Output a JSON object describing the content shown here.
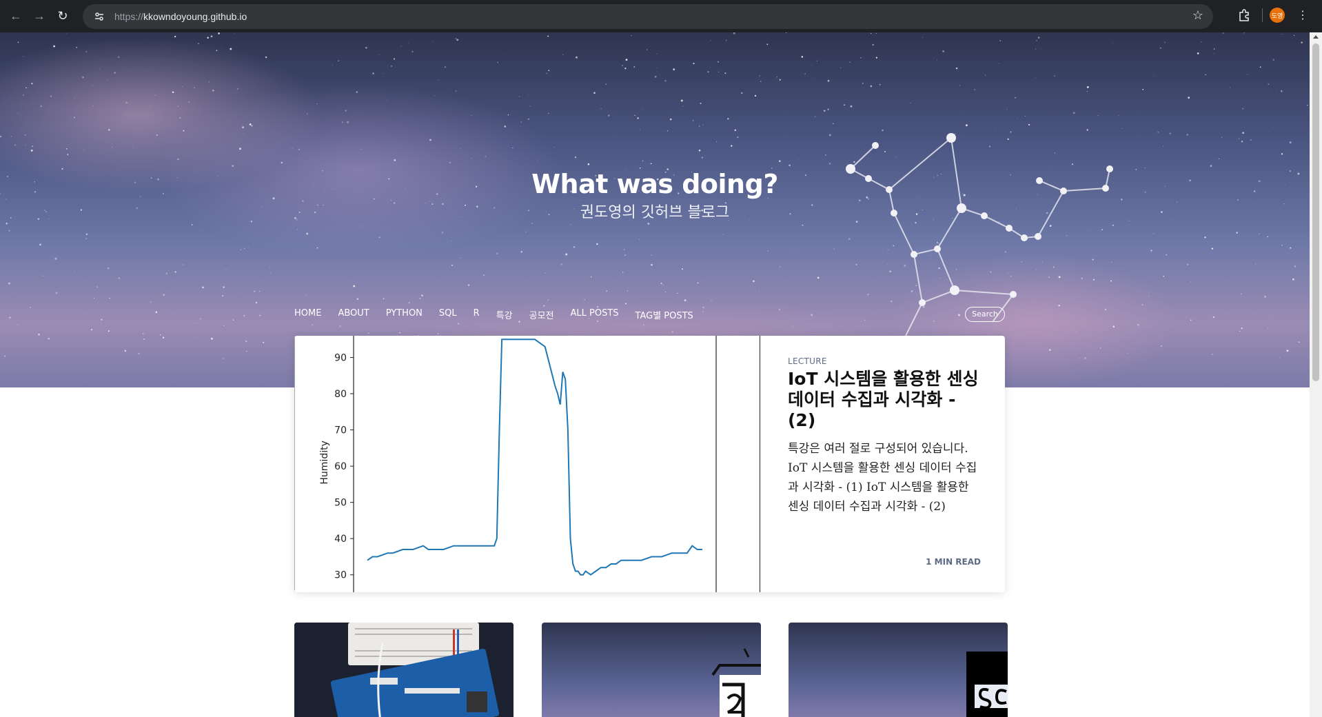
{
  "browser": {
    "url_scheme": "https://",
    "url_host": "kkowndoyoung.github.io",
    "profile_initials": "도영",
    "icons": [
      "back-icon",
      "forward-icon",
      "reload-icon",
      "site-info-icon",
      "bookmark-star-icon",
      "extensions-icon",
      "menu-icon"
    ]
  },
  "hero": {
    "title": "What was doing?",
    "subtitle": "권도영의 깃허브 블로그"
  },
  "nav": {
    "items": [
      "HOME",
      "ABOUT",
      "PYTHON",
      "SQL",
      "R",
      "특강",
      "공모전",
      "ALL POSTS",
      "TAG별 POSTS"
    ],
    "search_label": "Search"
  },
  "featured": {
    "category": "LECTURE",
    "title": "IoT 시스템을 활용한 센싱 데이터 수집과 시각화 - (2)",
    "excerpt": "특강은 여러 절로 구성되어 있습니다. IoT 시스템을 활용한 센싱 데이터 수집과 시각화 - (1) IoT 시스템을 활용한 센싱 데이터 수집과 시각화 - (2)",
    "read_time": "1 MIN READ"
  },
  "chart_data": {
    "type": "line",
    "ylabel": "Humidity",
    "xlabel": "",
    "title": "",
    "ylim": [
      29,
      96
    ],
    "yticks": [
      30,
      40,
      50,
      60,
      70,
      80,
      90
    ],
    "series": [
      {
        "color": "#1f77b4",
        "x": [
          0,
          2,
          4,
          8,
          10,
          14,
          18,
          22,
          24,
          26,
          30,
          34,
          38,
          42,
          46,
          50,
          51,
          52,
          53,
          54,
          55,
          56,
          57,
          58,
          60,
          62,
          66,
          70,
          74,
          75,
          76,
          77,
          78,
          79,
          80,
          81,
          82,
          83,
          84,
          85,
          86,
          88,
          90,
          92,
          94,
          96,
          98,
          100,
          104,
          108,
          112,
          116,
          120,
          124,
          126,
          128,
          130,
          132
        ],
        "y": [
          34,
          35,
          35,
          36,
          36,
          37,
          37,
          38,
          37,
          37,
          37,
          38,
          38,
          38,
          38,
          38,
          40,
          70,
          95,
          95,
          95,
          95,
          95,
          95,
          95,
          95,
          95,
          93,
          82,
          80,
          77,
          86,
          84,
          70,
          40,
          33,
          31,
          31,
          30,
          30,
          31,
          30,
          31,
          32,
          32,
          33,
          33,
          34,
          34,
          34,
          35,
          35,
          36,
          36,
          36,
          38,
          37,
          37
        ]
      }
    ]
  },
  "cards": [
    {
      "name": "arduino-card"
    },
    {
      "name": "card-2"
    },
    {
      "name": "card-3"
    }
  ],
  "colors": {
    "chrome_bg": "#202124",
    "omnibox_bg": "#35363a",
    "line": "#1f77b4",
    "tag": "#5b6b86"
  }
}
